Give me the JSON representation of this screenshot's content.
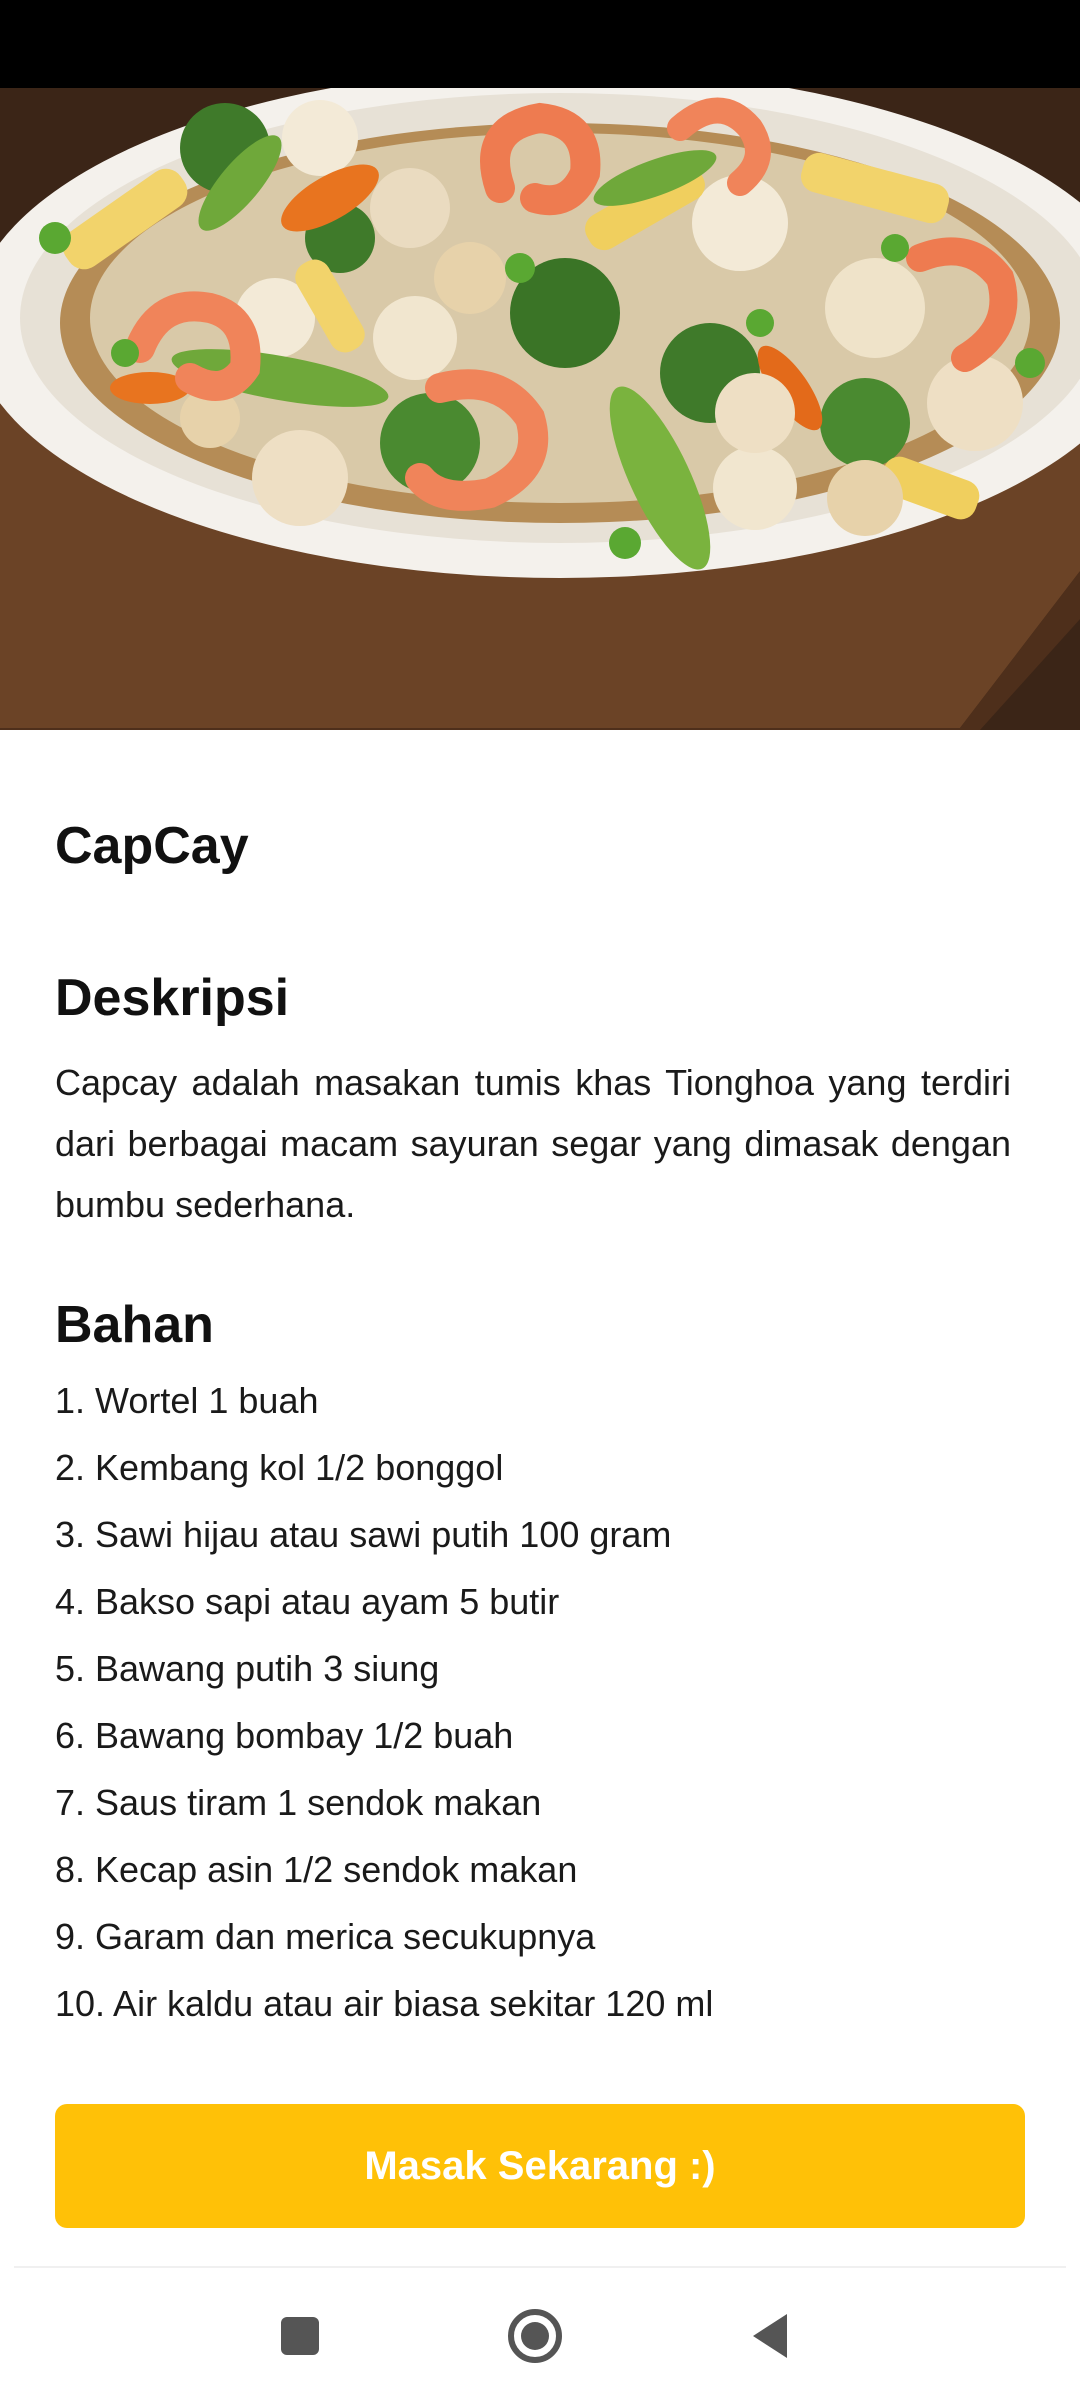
{
  "recipe": {
    "title": "CapCay",
    "image_alt": "Capcay dish photo"
  },
  "description": {
    "heading": "Deskripsi",
    "text": "Capcay adalah masakan tumis khas Tionghoa yang terdiri dari berbagai macam sayuran segar yang dimasak dengan bumbu sederhana."
  },
  "ingredients": {
    "heading": "Bahan",
    "items": [
      "1. Wortel 1 buah",
      "2. Kembang kol 1/2 bonggol",
      "3. Sawi hijau atau sawi putih 100 gram",
      "4. Bakso sapi atau ayam 5 butir",
      "5. Bawang putih 3 siung",
      "6. Bawang bombay 1/2 buah",
      "7. Saus tiram 1 sendok makan",
      "8. Kecap asin 1/2 sendok makan",
      "9. Garam dan merica secukupnya",
      "10. Air kaldu atau air biasa sekitar 120 ml"
    ]
  },
  "action": {
    "cook_label": "Masak Sekarang :)"
  },
  "navigation": {
    "recent_icon": "square-recent-apps-icon",
    "home_icon": "circle-home-icon",
    "back_icon": "triangle-back-icon"
  },
  "colors": {
    "accent": "#FFC107",
    "button_text": "#FFFFFF",
    "status_bar": "#000000"
  }
}
